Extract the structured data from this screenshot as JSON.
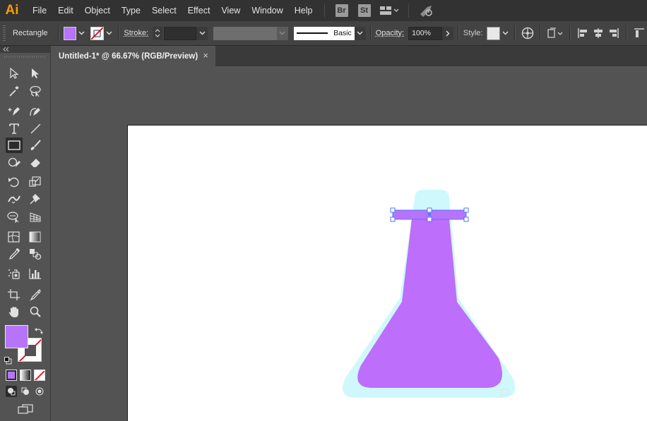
{
  "app": {
    "logo": "Ai"
  },
  "menu": [
    "File",
    "Edit",
    "Object",
    "Type",
    "Select",
    "Effect",
    "View",
    "Window",
    "Help"
  ],
  "bridge_badge": "Br",
  "stock_badge": "St",
  "control_bar": {
    "tool_name": "Rectangle",
    "fill_color": "#b873fb",
    "stroke_label": "Stroke:",
    "stroke_weight": "",
    "brush_label": "Basic",
    "opacity_label": "Opacity:",
    "opacity_value": "100%",
    "style_label": "Style:"
  },
  "document": {
    "tab_title": "Untitled-1* @ 66.67% (RGB/Preview)",
    "close_symbol": "×"
  },
  "tools_panel": {
    "fill_color": "#b873fb",
    "tools": [
      "selection",
      "direct-selection",
      "magic-wand",
      "lasso",
      "pen",
      "curvature",
      "type",
      "line-segment",
      "rectangle",
      "paintbrush",
      "shaper",
      "eraser",
      "rotate",
      "scale",
      "width",
      "puppet-warp",
      "shape-builder",
      "perspective-grid",
      "mesh",
      "gradient",
      "eyedropper",
      "blend",
      "symbol-sprayer",
      "column-graph",
      "artboard",
      "slice",
      "hand",
      "zoom"
    ]
  },
  "artwork": {
    "flask_outline_color": "#cff8fc",
    "flask_body_color": "#bd6efa",
    "selected_rect_color": "#b873fb",
    "selection_color": "#4a78ff"
  }
}
